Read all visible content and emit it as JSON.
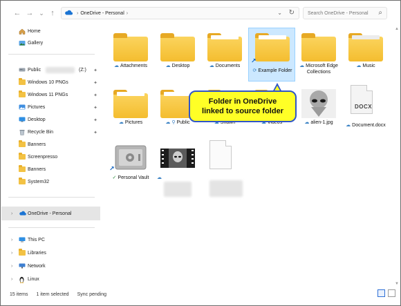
{
  "address": {
    "path": [
      "OneDrive - Personal"
    ],
    "search_placeholder": "Search OneDrive - Personal"
  },
  "sidebar": {
    "top": [
      {
        "label": "Home",
        "icon": "home-icon"
      },
      {
        "label": "Gallery",
        "icon": "gallery-icon"
      }
    ],
    "quick_access": [
      {
        "label": "Public",
        "suffix": "(Z:)",
        "pinned": true
      },
      {
        "label": "Windows 10 PNGs",
        "pinned": true
      },
      {
        "label": "Windows 11 PNGs",
        "pinned": true
      },
      {
        "label": "Pictures",
        "pinned": true
      },
      {
        "label": "Desktop",
        "pinned": true
      },
      {
        "label": "Recycle Bin",
        "pinned": true
      },
      {
        "label": "Banners",
        "pinned": false
      },
      {
        "label": "Screenpresso",
        "pinned": false
      },
      {
        "label": "Banners",
        "pinned": false
      },
      {
        "label": "System32",
        "pinned": false
      }
    ],
    "onedrive": {
      "label": "OneDrive - Personal"
    },
    "locations": [
      {
        "label": "This PC"
      },
      {
        "label": "Libraries"
      },
      {
        "label": "Network"
      },
      {
        "label": "Linux"
      }
    ]
  },
  "items": [
    {
      "label": "Attachments",
      "status": "cloud"
    },
    {
      "label": "Desktop",
      "status": "cloud"
    },
    {
      "label": "Documents",
      "status": "cloud"
    },
    {
      "label": "Example Folder",
      "status": "sync",
      "selected": true,
      "shortcut": true
    },
    {
      "label": "Microsoft Edge Collections",
      "status": "cloud"
    },
    {
      "label": "Music",
      "status": "cloud"
    },
    {
      "label": "Pictures",
      "status": "cloud"
    },
    {
      "label": "Public",
      "status": "cloud-user"
    },
    {
      "label": "Shawn",
      "status": "cloud"
    },
    {
      "label": "Videos",
      "status": "cloud"
    },
    {
      "label": "alien-1.jpg",
      "status": "cloud"
    },
    {
      "label": "Document.docx",
      "status": "cloud"
    },
    {
      "label": "Personal Vault",
      "status": "check"
    },
    {
      "label": "",
      "status": "cloud"
    },
    {
      "label": "",
      "status": ""
    }
  ],
  "docx_badge": "DOCX",
  "callout": {
    "line1": "Folder in OneDrive",
    "line2": "linked to source folder"
  },
  "status_bar": {
    "count": "15 items",
    "selected": "1 item selected",
    "sync": "Sync pending"
  },
  "colors": {
    "accent": "#0078d4",
    "folder": "#f4bd2f",
    "callout_fill": "#ffff26",
    "callout_border": "#2f55c8",
    "selection": "#cce8ff"
  }
}
